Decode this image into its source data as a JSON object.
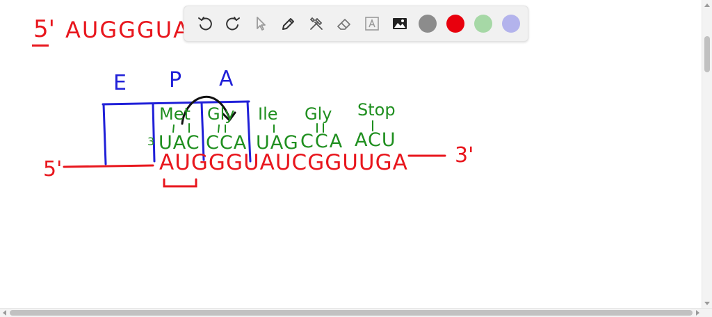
{
  "notes": {
    "header_prime": "5'",
    "header_sequence": "AUGGGUAU",
    "site_e": "E",
    "site_p": "P",
    "site_a": "A",
    "amino_acids": [
      "Met",
      "Gly",
      "Ile",
      "Gly",
      "Stop"
    ],
    "anticodon_prime": "3",
    "anticodons": [
      "UAC",
      "CCA",
      "UAG",
      "CCA",
      "ACU"
    ],
    "mrna_5prime": "5'",
    "mrna_sequence": "AUGGGUAUCGGUUGA",
    "mrna_3prime": "3'"
  },
  "toolbar": {
    "tools": [
      {
        "name": "undo-icon"
      },
      {
        "name": "redo-icon"
      },
      {
        "name": "select-arrow-icon"
      },
      {
        "name": "pen-icon"
      },
      {
        "name": "tools-icon"
      },
      {
        "name": "eraser-icon"
      },
      {
        "name": "text-icon"
      },
      {
        "name": "image-icon"
      }
    ],
    "colors": [
      "#8c8c8c",
      "#e8000d",
      "#a6d8a6",
      "#b3b3ec"
    ]
  },
  "palette": {
    "red": "#e8161d",
    "blue": "#2020d8",
    "green": "#1f8f1f",
    "black": "#111111"
  }
}
